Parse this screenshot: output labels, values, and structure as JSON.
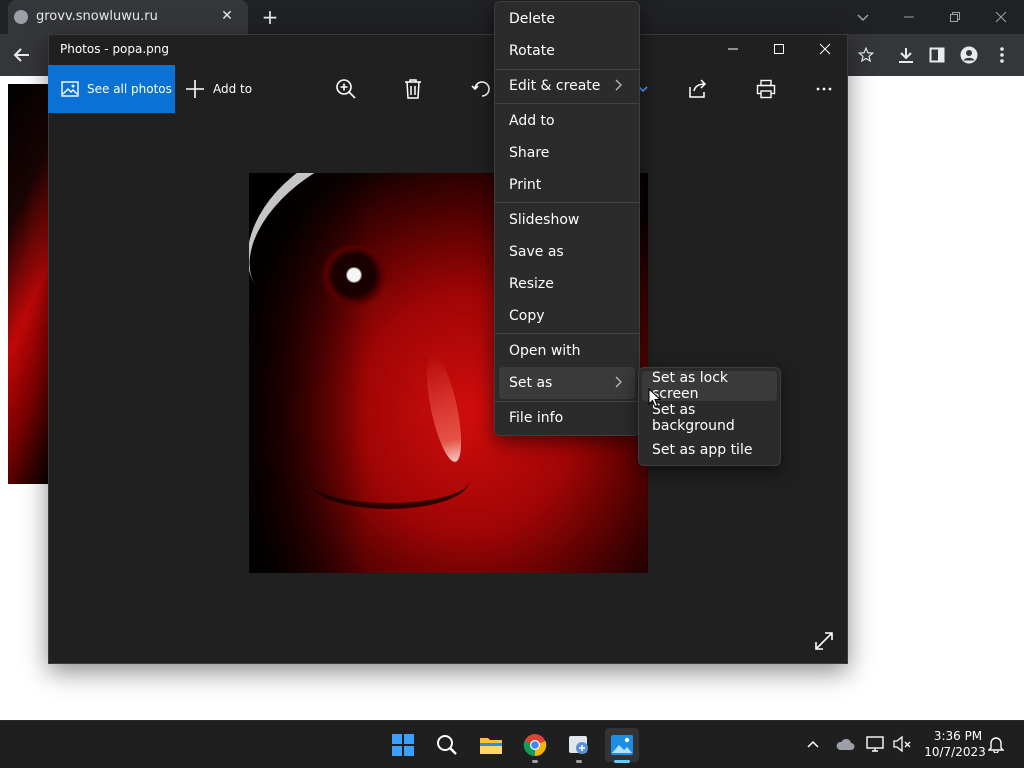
{
  "browser": {
    "tab_title": "grovv.snowluwu.ru",
    "tab_close": "✕",
    "new_tab": "+"
  },
  "photos": {
    "window_title": "Photos - popa.png",
    "see_all_photos": "See all photos",
    "add_to": "Add to",
    "image_caption": ""
  },
  "context_menu": {
    "items": [
      {
        "label": "Delete"
      },
      {
        "label": "Rotate"
      },
      {
        "label": "Edit & create",
        "submenu": true
      },
      {
        "label": "Add to"
      },
      {
        "label": "Share"
      },
      {
        "label": "Print"
      },
      {
        "label": "Slideshow"
      },
      {
        "label": "Save as"
      },
      {
        "label": "Resize"
      },
      {
        "label": "Copy"
      },
      {
        "label": "Open with"
      },
      {
        "label": "Set as",
        "submenu": true,
        "highlighted": true
      },
      {
        "label": "File info"
      }
    ]
  },
  "set_as_submenu": {
    "items": [
      {
        "label": "Set as lock screen",
        "highlighted": true
      },
      {
        "label": "Set as background"
      },
      {
        "label": "Set as app tile"
      }
    ]
  },
  "taskbar": {
    "time": "3:36 PM",
    "date": "10/7/2023"
  },
  "colors": {
    "accent": "#0a72d4",
    "menu_bg": "#2b2b2b",
    "photos_bg": "#202020"
  }
}
